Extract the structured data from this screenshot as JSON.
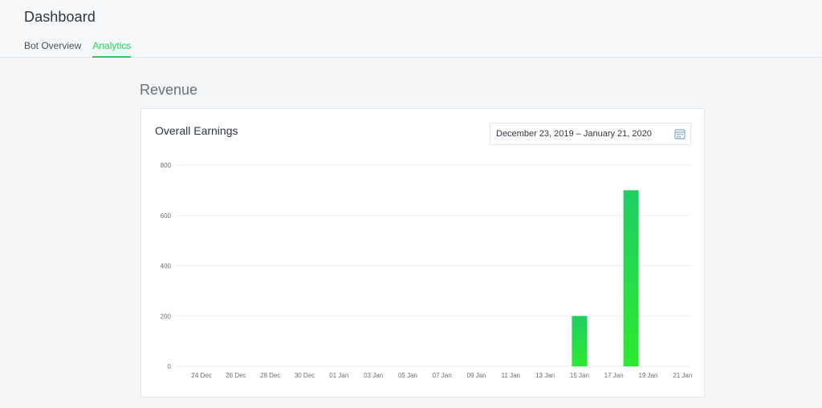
{
  "header": {
    "title": "Dashboard",
    "tabs": [
      {
        "label": "Bot Overview",
        "active": false
      },
      {
        "label": "Analytics",
        "active": true
      }
    ]
  },
  "section": {
    "title": "Revenue"
  },
  "card": {
    "title": "Overall Earnings",
    "date_range": "December 23, 2019 – January 21, 2020",
    "calendar_icon": "calendar-icon"
  },
  "colors": {
    "accent": "#2ecc60",
    "bar_top": "#1ecf63",
    "bar_bottom": "#2bea2f",
    "grid": "#ebedf0",
    "axis_text": "#6b7079"
  },
  "chart_data": {
    "type": "bar",
    "title": "",
    "xlabel": "",
    "ylabel": "",
    "ylim": [
      0,
      800
    ],
    "yticks": [
      0,
      200,
      400,
      600,
      800
    ],
    "grid": true,
    "x_ticks": [
      "24 Dec",
      "26 Dec",
      "28 Dec",
      "30 Dec",
      "01 Jan",
      "03 Jan",
      "05 Jan",
      "07 Jan",
      "09 Jan",
      "11 Jan",
      "13 Jan",
      "15 Jan",
      "17 Jan",
      "19 Jan",
      "21 Jan"
    ],
    "bars": [
      {
        "x": "15 Jan",
        "value": 200
      },
      {
        "x": "18 Jan",
        "value": 700
      }
    ]
  }
}
